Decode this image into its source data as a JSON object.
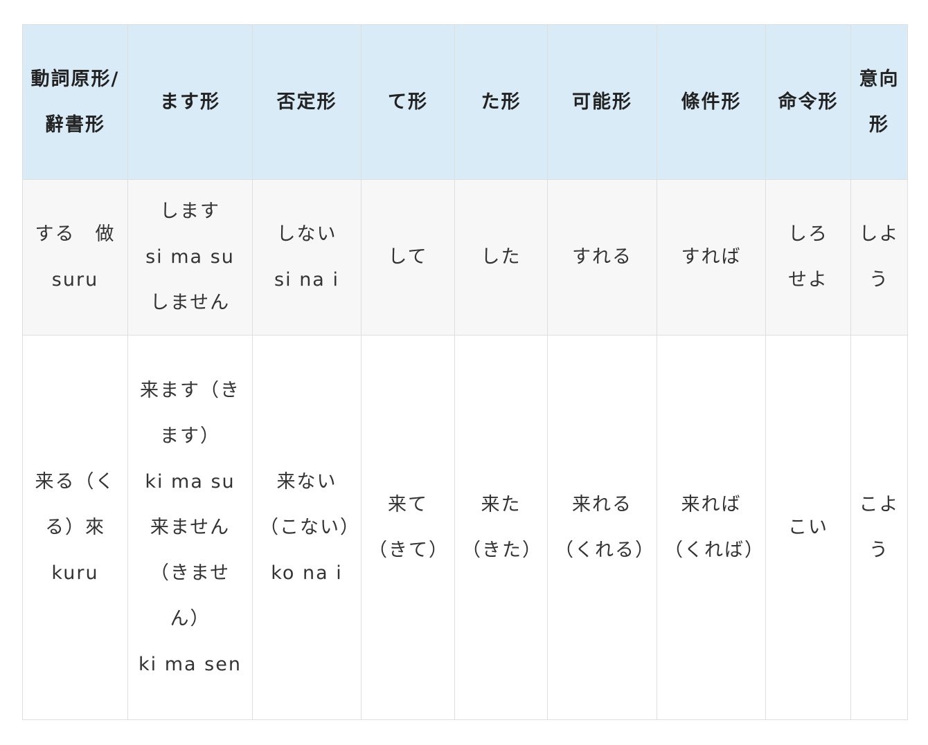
{
  "table": {
    "headers": [
      "動詞原形/辭書形",
      "ます形",
      "否定形",
      "て形",
      "た形",
      "可能形",
      "條件形",
      "命令形",
      "意向形"
    ],
    "rows": [
      [
        [
          "する　做",
          "suru"
        ],
        [
          "します",
          "si ma su",
          "しません"
        ],
        [
          "しない",
          "si na i"
        ],
        [
          "して"
        ],
        [
          "した"
        ],
        [
          "すれる"
        ],
        [
          "すれば"
        ],
        [
          "しろ",
          "せよ"
        ],
        [
          "しよう"
        ]
      ],
      [
        [
          "来る（くる）來",
          "kuru"
        ],
        [
          "来ます（きます）",
          "ki ma su",
          "来ません（きません）",
          "ki ma sen"
        ],
        [
          "来ない（こない）",
          "ko na i"
        ],
        [
          "来て（きて）"
        ],
        [
          "来た（きた）"
        ],
        [
          "来れる（くれる）"
        ],
        [
          "来れば（くれば）"
        ],
        [
          "こい"
        ],
        [
          "こよう"
        ]
      ]
    ]
  }
}
